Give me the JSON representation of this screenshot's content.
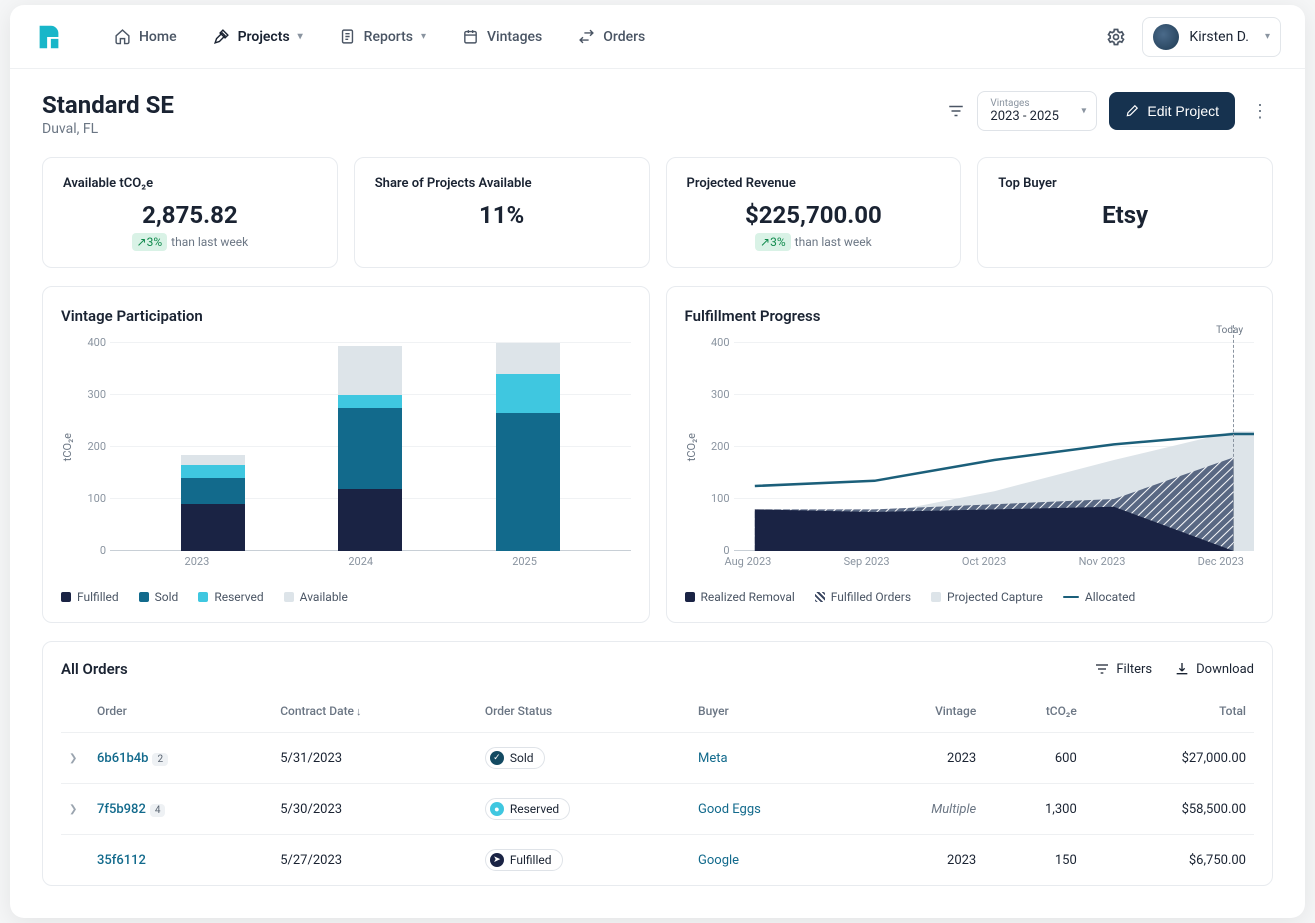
{
  "nav": {
    "home": "Home",
    "projects": "Projects",
    "reports": "Reports",
    "vintages": "Vintages",
    "orders": "Orders"
  },
  "user": {
    "name": "Kirsten D."
  },
  "page": {
    "title": "Standard SE",
    "subtitle": "Duval, FL"
  },
  "filters": {
    "vintages_label": "Vintages",
    "vintages_value": "2023 - 2025",
    "edit_project": "Edit Project"
  },
  "kpi": {
    "available": {
      "label": "Available tCO₂e",
      "value": "2,875.82",
      "delta_pct": "3%",
      "delta_text": "than last week"
    },
    "share": {
      "label": "Share of Projects Available",
      "value": "11%"
    },
    "revenue": {
      "label": "Projected Revenue",
      "value": "$225,700.00",
      "delta_pct": "3%",
      "delta_text": "than last week"
    },
    "top_buyer": {
      "label": "Top Buyer",
      "value": "Etsy"
    }
  },
  "charts": {
    "vintage": {
      "title": "Vintage Participation",
      "y_label": "tCO₂e",
      "legend": {
        "fulfilled": "Fulfilled",
        "sold": "Sold",
        "reserved": "Reserved",
        "available": "Available"
      }
    },
    "fulfillment": {
      "title": "Fulfillment Progress",
      "y_label": "tCO₂e",
      "today_label": "Today",
      "legend": {
        "realized": "Realized Removal",
        "fulfilled_orders": "Fulfilled Orders",
        "projected": "Projected Capture",
        "allocated": "Allocated"
      }
    }
  },
  "chart_data": [
    {
      "type": "bar",
      "title": "Vintage Participation",
      "ylabel": "tCO₂e",
      "ylim": [
        0,
        400
      ],
      "y_ticks": [
        0,
        100,
        200,
        300,
        400
      ],
      "categories": [
        "2023",
        "2024",
        "2025"
      ],
      "series": [
        {
          "name": "Fulfilled",
          "values": [
            90,
            120,
            0
          ]
        },
        {
          "name": "Sold",
          "values": [
            50,
            155,
            265
          ]
        },
        {
          "name": "Reserved",
          "values": [
            25,
            25,
            75
          ]
        },
        {
          "name": "Available",
          "values": [
            20,
            95,
            60
          ]
        }
      ]
    },
    {
      "type": "area",
      "title": "Fulfillment Progress",
      "ylabel": "tCO₂e",
      "ylim": [
        0,
        400
      ],
      "y_ticks": [
        0,
        100,
        200,
        300,
        400
      ],
      "categories": [
        "Aug 2023",
        "Sep 2023",
        "Oct 2023",
        "Nov 2023",
        "Dec 2023"
      ],
      "today_marker": "Dec 2023",
      "series": [
        {
          "name": "Allocated",
          "kind": "line",
          "values": [
            125,
            135,
            175,
            205,
            225
          ]
        },
        {
          "name": "Projected Capture",
          "kind": "area",
          "values": [
            30,
            70,
            115,
            175,
            230
          ]
        },
        {
          "name": "Fulfilled Orders",
          "kind": "area",
          "values": [
            80,
            80,
            90,
            100,
            180
          ]
        },
        {
          "name": "Realized Removal",
          "kind": "area",
          "values": [
            80,
            75,
            80,
            85,
            0
          ]
        }
      ]
    }
  ],
  "orders_table": {
    "title": "All Orders",
    "filters": "Filters",
    "download": "Download",
    "columns": {
      "order": "Order",
      "contract_date": "Contract Date",
      "order_status": "Order Status",
      "buyer": "Buyer",
      "vintage": "Vintage",
      "tco2e": "tCO₂e",
      "total": "Total"
    },
    "rows": [
      {
        "id": "6b61b4b",
        "badge": "2",
        "date": "5/31/2023",
        "status": "Sold",
        "buyer": "Meta",
        "vintage": "2023",
        "tco2e": "600",
        "total": "$27,000.00"
      },
      {
        "id": "7f5b982",
        "badge": "4",
        "date": "5/30/2023",
        "status": "Reserved",
        "buyer": "Good Eggs",
        "vintage": "Multiple",
        "tco2e": "1,300",
        "total": "$58,500.00"
      },
      {
        "id": "35f6112",
        "badge": "",
        "date": "5/27/2023",
        "status": "Fulfilled",
        "buyer": "Google",
        "vintage": "2023",
        "tco2e": "150",
        "total": "$6,750.00"
      }
    ]
  }
}
